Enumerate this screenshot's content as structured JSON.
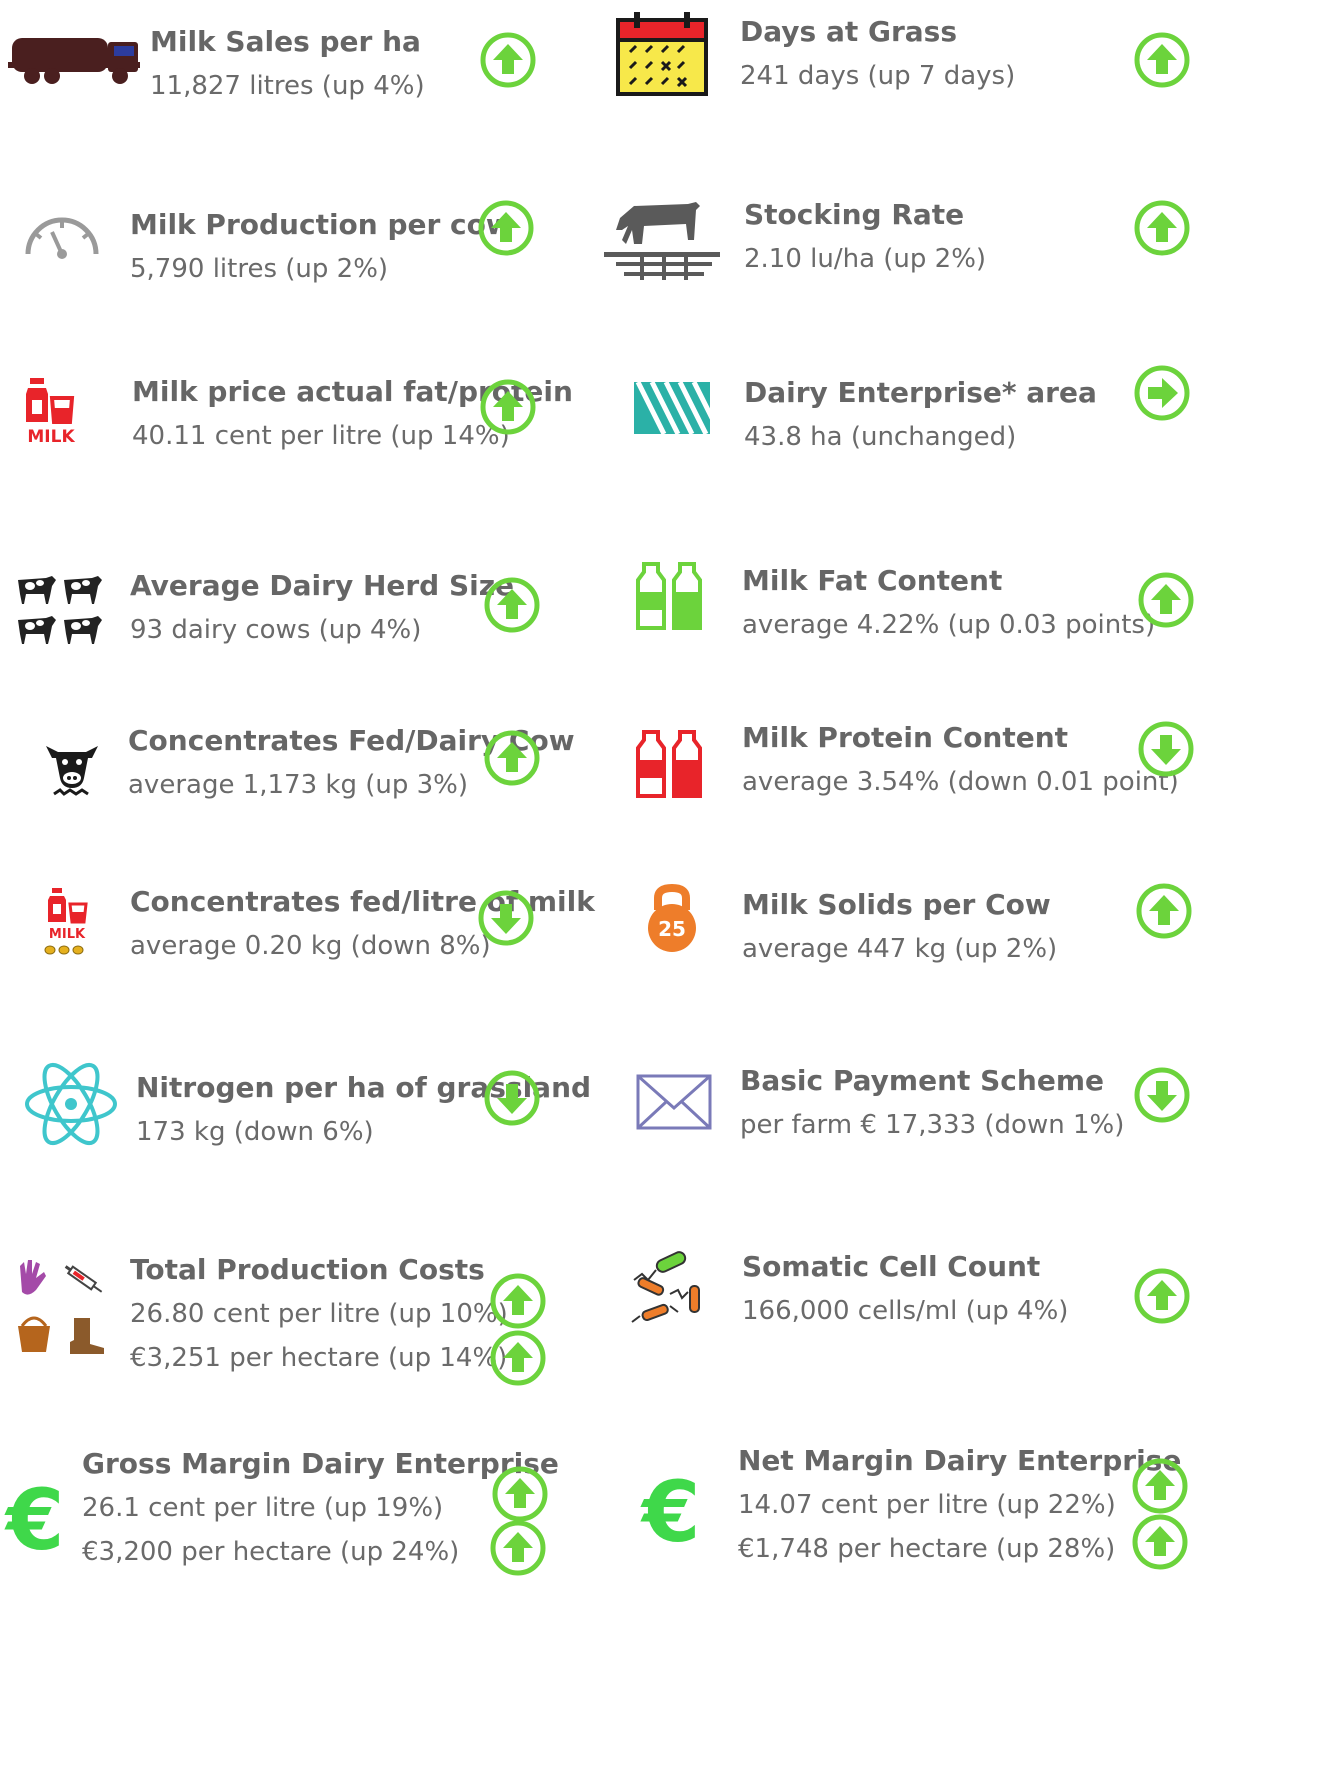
{
  "colors": {
    "indicator_green": "#6cd33c",
    "text_gray": "#6a6a6a",
    "red": "#e8242a",
    "teal": "#2bb1a7",
    "orange": "#ee7d2a",
    "purple": "#7a7ab8",
    "cyan": "#3fc6cc"
  },
  "indicators": [
    {
      "title": "Milk Sales per ha",
      "lines": [
        "11,827 litres (up 4%)"
      ],
      "icon": "milk-tanker-truck-icon",
      "trend": [
        "up"
      ]
    },
    {
      "title": "Days at Grass",
      "lines": [
        "241 days (up 7 days)"
      ],
      "icon": "calendar-icon",
      "trend": [
        "up"
      ]
    },
    {
      "title": "Milk Production per cow",
      "lines": [
        "5,790 litres (up 2%)"
      ],
      "icon": "gauge-icon",
      "trend": [
        "up"
      ]
    },
    {
      "title": "Stocking Rate",
      "lines": [
        "2.10 lu/ha (up 2%)"
      ],
      "icon": "grazing-cow-icon",
      "trend": [
        "up"
      ]
    },
    {
      "title": "Milk price actual fat/protein",
      "lines": [
        "40.11 cent per litre (up 14%)"
      ],
      "icon": "milk-bottle-icon",
      "icon_text": "MILK",
      "trend": [
        "up"
      ]
    },
    {
      "title": "Dairy Enterprise* area",
      "lines": [
        "43.8 ha (unchanged)"
      ],
      "icon": "field-area-icon",
      "trend": [
        "right"
      ]
    },
    {
      "title": "Average Dairy Herd Size",
      "lines": [
        "93 dairy cows (up 4%)"
      ],
      "icon": "cow-herd-icon",
      "trend": [
        "up"
      ]
    },
    {
      "title": "Milk Fat Content",
      "lines": [
        "average 4.22% (up 0.03 points)"
      ],
      "icon": "green-bottles-icon",
      "trend": [
        "up"
      ]
    },
    {
      "title": "Concentrates Fed/Dairy Cow",
      "lines": [
        "average 1,173 kg (up 3%)"
      ],
      "icon": "cow-face-icon",
      "trend": [
        "up"
      ]
    },
    {
      "title": "Milk Protein Content",
      "lines": [
        "average 3.54% (down 0.01 point)"
      ],
      "icon": "red-bottles-icon",
      "trend": [
        "down"
      ]
    },
    {
      "title": "Concentrates fed/litre of milk",
      "lines": [
        "average 0.20 kg (down 8%)"
      ],
      "icon": "milk-with-pellets-icon",
      "icon_text": "MILK",
      "trend": [
        "down"
      ]
    },
    {
      "title": "Milk Solids per Cow",
      "lines": [
        "average 447 kg (up 2%)"
      ],
      "icon": "kettlebell-icon",
      "icon_text": "25",
      "trend": [
        "up"
      ]
    },
    {
      "title": "Nitrogen per ha of grassland",
      "lines": [
        "173 kg (down 6%)"
      ],
      "icon": "atom-icon",
      "trend": [
        "down"
      ]
    },
    {
      "title": "Basic Payment Scheme",
      "lines": [
        "per farm € 17,333 (down 1%)"
      ],
      "icon": "envelope-icon",
      "trend": [
        "down"
      ]
    },
    {
      "title": "Total Production Costs",
      "lines": [
        "26.80 cent per litre (up 10%)",
        "€3,251 per hectare (up 14%)"
      ],
      "icon": "farm-supplies-icon",
      "trend": [
        "up",
        "up"
      ]
    },
    {
      "title": "Somatic Cell Count",
      "lines": [
        "166,000 cells/ml (up 4%)"
      ],
      "icon": "cells-icon",
      "trend": [
        "up"
      ]
    },
    {
      "title": "Gross Margin Dairy Enterprise",
      "lines": [
        "26.1 cent per litre (up 19%)",
        "€3,200 per hectare (up 24%)"
      ],
      "icon": "euro-icon",
      "icon_text": "€",
      "trend": [
        "up",
        "up"
      ]
    },
    {
      "title": "Net Margin Dairy Enterprise",
      "lines": [
        "14.07 cent per litre (up 22%)",
        "€1,748 per hectare (up 28%)"
      ],
      "icon": "euro-icon",
      "icon_text": "€",
      "trend": [
        "up",
        "up"
      ]
    }
  ]
}
